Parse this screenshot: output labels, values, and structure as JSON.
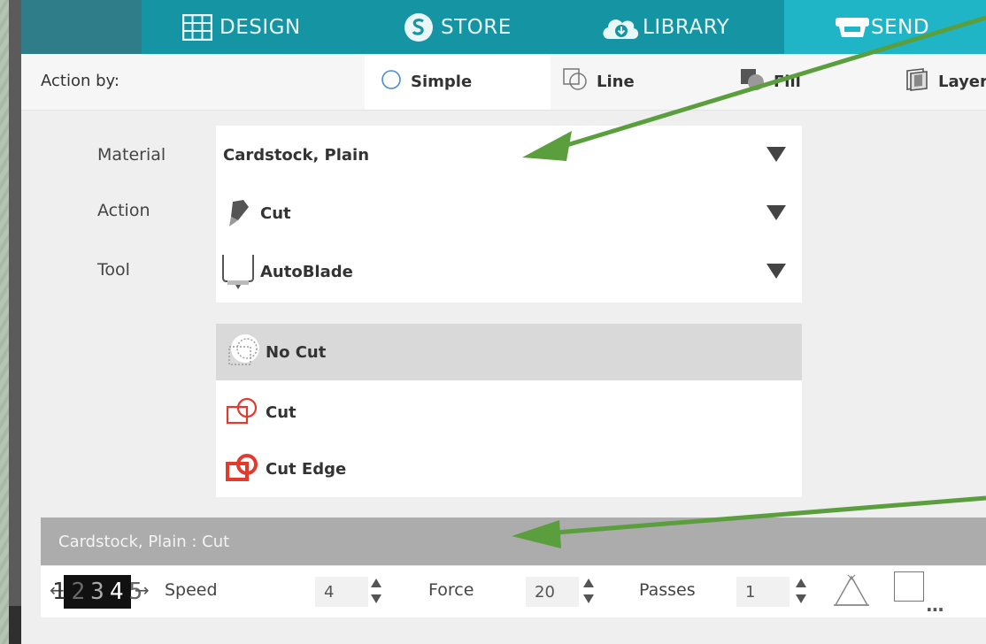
{
  "nav": {
    "items": [
      {
        "label": "DESIGN",
        "icon": "grid-icon"
      },
      {
        "label": "STORE",
        "icon": "store-logo-icon"
      },
      {
        "label": "LIBRARY",
        "icon": "cloud-download-icon"
      },
      {
        "label": "SEND",
        "icon": "cutter-machine-icon",
        "active": true
      }
    ],
    "accent": "#1594a3",
    "active_color": "#1fb5c6"
  },
  "action_by": {
    "label": "Action by:",
    "tabs": [
      {
        "label": "Simple",
        "icon": "circle-icon",
        "active": true
      },
      {
        "label": "Line",
        "icon": "line-outline-icon"
      },
      {
        "label": "Fill",
        "icon": "fill-shape-icon"
      },
      {
        "label": "Layer",
        "icon": "layer-icon"
      }
    ]
  },
  "form": {
    "material_label": "Material",
    "material_value": "Cardstock, Plain",
    "action_label": "Action",
    "action_value": "Cut",
    "tool_label": "Tool",
    "tool_value": "AutoBlade"
  },
  "cut_options": [
    {
      "label": "No Cut",
      "icon": "no-cut-icon",
      "selected": true
    },
    {
      "label": "Cut",
      "icon": "cut-icon",
      "selected": false
    },
    {
      "label": "Cut Edge",
      "icon": "cut-edge-icon",
      "selected": false
    }
  ],
  "summary": "Cardstock, Plain : Cut",
  "controls": {
    "blade_digits": [
      "1",
      "2",
      "3",
      "4",
      "5"
    ],
    "speed_label": "Speed",
    "speed_value": "4",
    "force_label": "Force",
    "force_value": "20",
    "passes_label": "Passes",
    "passes_value": "1",
    "more_label": "..."
  },
  "annotation_arrow_color": "#5b9e3e"
}
